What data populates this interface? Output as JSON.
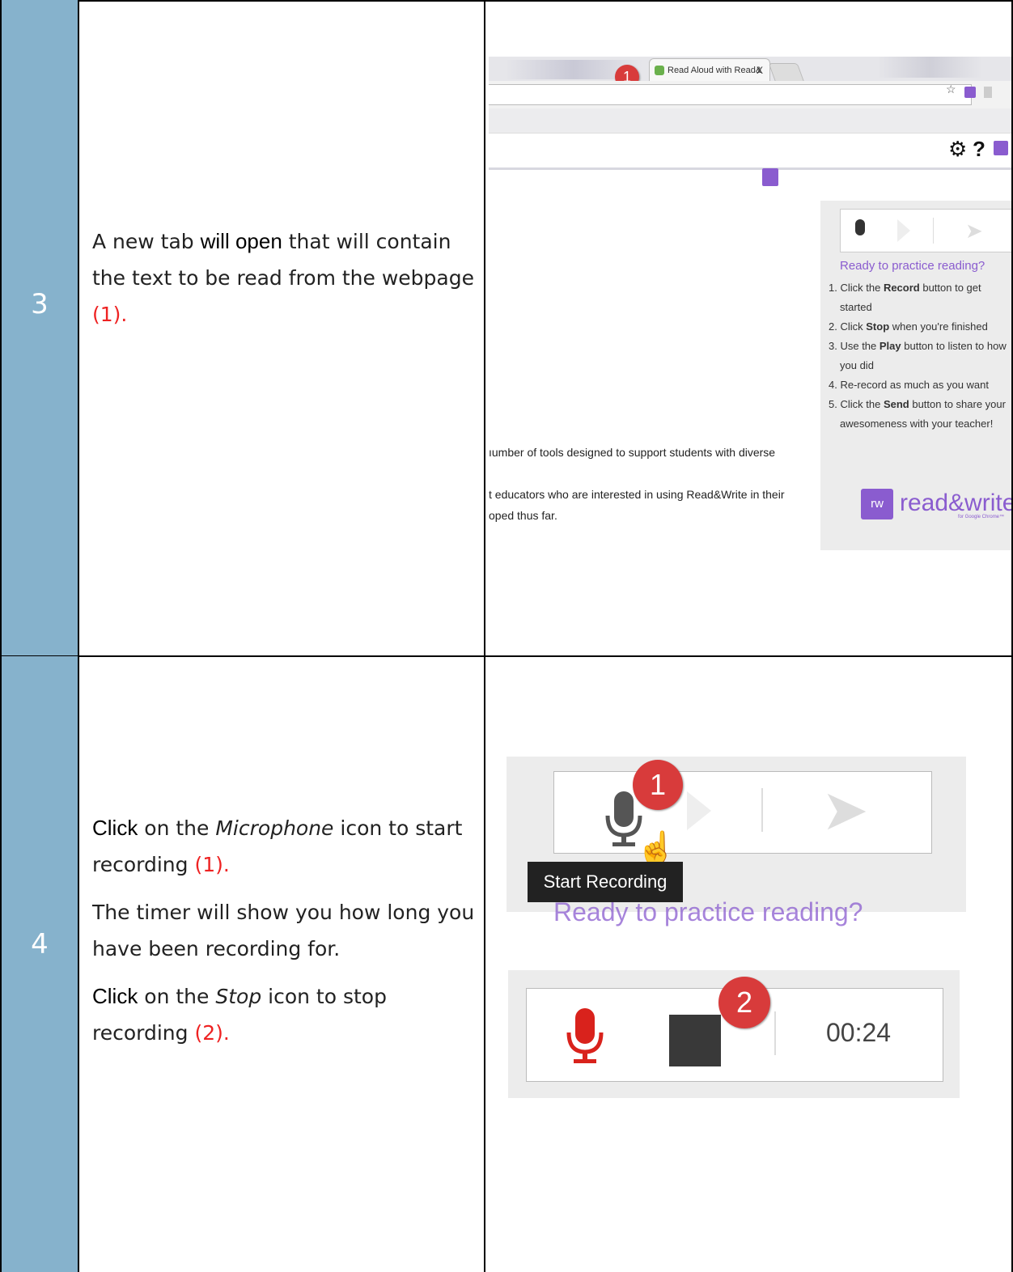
{
  "row3": {
    "step": "3",
    "text": {
      "a": "A new tab ",
      "b": "will open",
      "c": " that will contain the text to be read from the webpage ",
      "d": "(1)."
    },
    "screenshot": {
      "tab_title": "Read Aloud with Read&",
      "tab_close": "X",
      "badge": "1",
      "star": "☆",
      "gear": "⚙",
      "help": "?",
      "ready": "Ready to practice reading?",
      "steps": [
        {
          "n": "1.",
          "pre": "Click the ",
          "b": "Record",
          "post": " button to get started"
        },
        {
          "n": "2.",
          "pre": "Click ",
          "b": "Stop",
          "post": " when you're finished"
        },
        {
          "n": "3.",
          "pre": "Use the ",
          "b": "Play",
          "post": " button to listen to how you did"
        },
        {
          "n": "4.",
          "pre": "Re-record as much as you want",
          "b": "",
          "post": ""
        },
        {
          "n": "5.",
          "pre": "Click the ",
          "b": "Send",
          "post": " button to share your awesomeness with your teacher!"
        }
      ],
      "logo_rw": "rw",
      "logo_word": "read&write",
      "logo_sub": "for Google Chrome™",
      "body_line1": "ıumber of tools designed to support students with diverse",
      "body_line2": "t educators who are interested in using Read&Write in their",
      "body_line3": "oped thus far."
    }
  },
  "row4": {
    "step": "4",
    "p1": {
      "a": "Click",
      "b": " on the ",
      "c": "Microphone",
      "d": " icon to start recording ",
      "e": "(1)."
    },
    "p2": "The timer will show you how long you have been recording for.",
    "p3": {
      "a": "Click",
      "b": " on the ",
      "c": "Stop",
      "d": " icon to stop recording ",
      "e": "(2)."
    },
    "shot1": {
      "badge": "1",
      "tooltip": "Start Recording",
      "ghost": "Ready to practice reading?"
    },
    "shot2": {
      "badge": "2",
      "timer": "00:24"
    }
  },
  "colors": {
    "step_column": "#86b2cc",
    "accent_red": "#e22222",
    "brand_purple": "#8a5ccf"
  }
}
